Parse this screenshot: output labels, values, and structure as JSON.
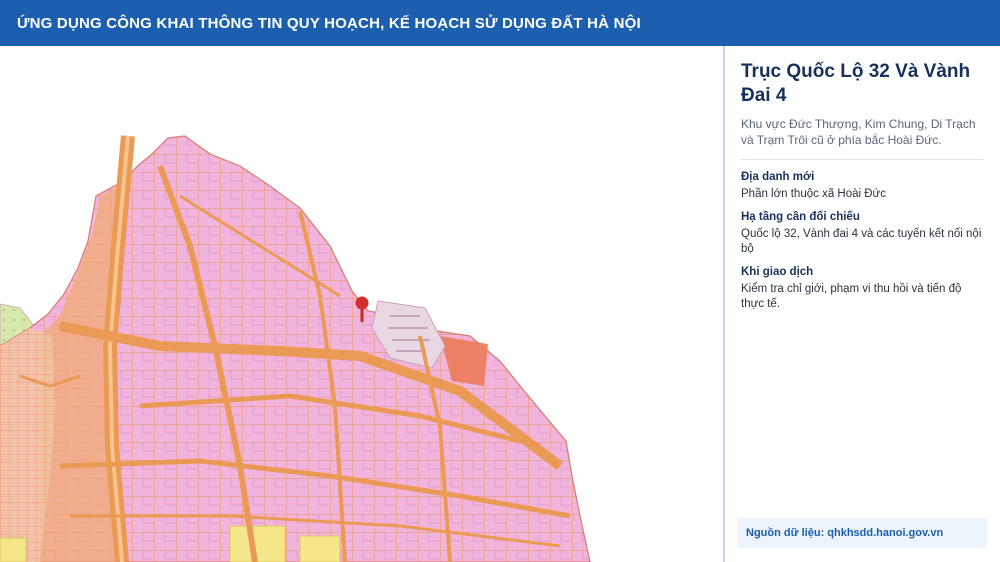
{
  "header": {
    "title": "ỨNG DỤNG CÔNG KHAI THÔNG TIN QUY HOẠCH, KẾ HOẠCH SỬ DỤNG ĐẤT HÀ NỘI"
  },
  "map": {
    "marker_icon": "map-pin-icon",
    "colors": {
      "residential": "#f1b4dc",
      "road": "#f0a460",
      "green": "#d5e7a8",
      "industrial": "#ec7b5a",
      "yellow": "#f5e68a"
    }
  },
  "panel": {
    "title": "Trục Quốc Lộ 32 Và Vành Đai 4",
    "subtitle": "Khu vực Đức Thượng, Kim Chung, Di Trạch và Trạm Trôi cũ ở phía bắc Hoài Đức.",
    "sections": [
      {
        "label": "Địa danh mới",
        "value": "Phần lớn thuộc xã Hoài Đức"
      },
      {
        "label": "Hạ tầng cần đối chiếu",
        "value": "Quốc lộ 32, Vành đai 4 và các tuyến kết nối nội bộ"
      },
      {
        "label": "Khi giao dịch",
        "value": "Kiểm tra chỉ giới, phạm vi thu hồi và tiến độ thực tế."
      }
    ],
    "source": "Nguồn dữ liệu: qhkhsdd.hanoi.gov.vn"
  }
}
